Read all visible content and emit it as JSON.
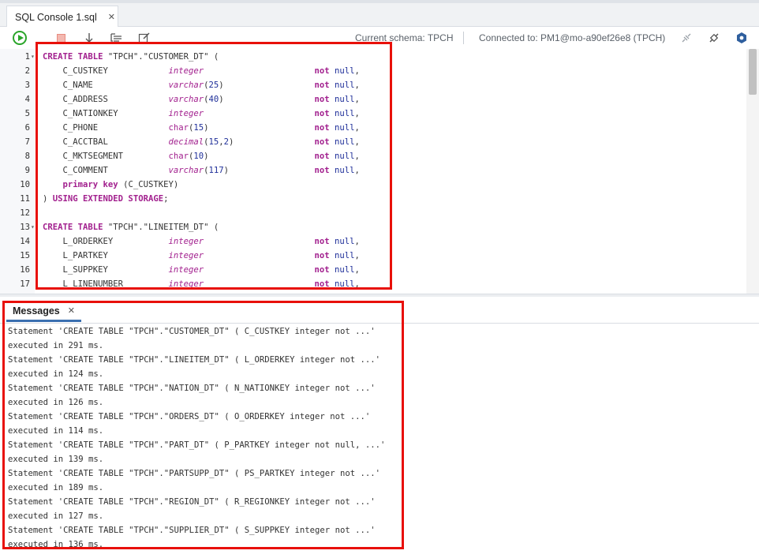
{
  "tab": {
    "title": "SQL Console 1.sql",
    "close": "✕"
  },
  "toolbar": {
    "current_schema": "Current schema: TPCH",
    "connected_to": "Connected to: PM1@mo-a90ef26e8 (TPCH)"
  },
  "editor": {
    "lines": [
      [
        [
          "CREATE TABLE",
          "kw"
        ],
        [
          " \"TPCH\".\"CUSTOMER_DT\" (",
          ""
        ]
      ],
      [
        [
          "    C_CUSTKEY            ",
          ""
        ],
        [
          "integer",
          "ty"
        ],
        [
          "                      ",
          ""
        ],
        [
          "not",
          "nn"
        ],
        [
          " ",
          ""
        ],
        [
          "null",
          "nm"
        ],
        [
          ",",
          ""
        ]
      ],
      [
        [
          "    C_NAME               ",
          ""
        ],
        [
          "varchar",
          "ty"
        ],
        [
          "(",
          ""
        ],
        [
          "25",
          "nm"
        ],
        [
          ")",
          ""
        ],
        [
          "                  ",
          ""
        ],
        [
          "not",
          "nn"
        ],
        [
          " ",
          ""
        ],
        [
          "null",
          "nm"
        ],
        [
          ",",
          ""
        ]
      ],
      [
        [
          "    C_ADDRESS            ",
          ""
        ],
        [
          "varchar",
          "ty"
        ],
        [
          "(",
          ""
        ],
        [
          "40",
          "nm"
        ],
        [
          ")",
          ""
        ],
        [
          "                  ",
          ""
        ],
        [
          "not",
          "nn"
        ],
        [
          " ",
          ""
        ],
        [
          "null",
          "nm"
        ],
        [
          ",",
          ""
        ]
      ],
      [
        [
          "    C_NATIONKEY          ",
          ""
        ],
        [
          "integer",
          "ty"
        ],
        [
          "                      ",
          ""
        ],
        [
          "not",
          "nn"
        ],
        [
          " ",
          ""
        ],
        [
          "null",
          "nm"
        ],
        [
          ",",
          ""
        ]
      ],
      [
        [
          "    C_PHONE              ",
          ""
        ],
        [
          "char",
          "ty2"
        ],
        [
          "(",
          ""
        ],
        [
          "15",
          "nm"
        ],
        [
          ")",
          ""
        ],
        [
          "                     ",
          ""
        ],
        [
          "not",
          "nn"
        ],
        [
          " ",
          ""
        ],
        [
          "null",
          "nm"
        ],
        [
          ",",
          ""
        ]
      ],
      [
        [
          "    C_ACCTBAL            ",
          ""
        ],
        [
          "decimal",
          "ty"
        ],
        [
          "(",
          ""
        ],
        [
          "15",
          "nm"
        ],
        [
          ",",
          ""
        ],
        [
          "2",
          "nm"
        ],
        [
          ")",
          ""
        ],
        [
          "                ",
          ""
        ],
        [
          "not",
          "nn"
        ],
        [
          " ",
          ""
        ],
        [
          "null",
          "nm"
        ],
        [
          ",",
          ""
        ]
      ],
      [
        [
          "    C_MKTSEGMENT         ",
          ""
        ],
        [
          "char",
          "ty2"
        ],
        [
          "(",
          ""
        ],
        [
          "10",
          "nm"
        ],
        [
          ")",
          ""
        ],
        [
          "                     ",
          ""
        ],
        [
          "not",
          "nn"
        ],
        [
          " ",
          ""
        ],
        [
          "null",
          "nm"
        ],
        [
          ",",
          ""
        ]
      ],
      [
        [
          "    C_COMMENT            ",
          ""
        ],
        [
          "varchar",
          "ty"
        ],
        [
          "(",
          ""
        ],
        [
          "117",
          "nm"
        ],
        [
          ")",
          ""
        ],
        [
          "                 ",
          ""
        ],
        [
          "not",
          "nn"
        ],
        [
          " ",
          ""
        ],
        [
          "null",
          "nm"
        ],
        [
          ",",
          ""
        ]
      ],
      [
        [
          "    ",
          ""
        ],
        [
          "primary key",
          "kw"
        ],
        [
          " (C_CUSTKEY)",
          ""
        ]
      ],
      [
        [
          ") ",
          ""
        ],
        [
          "USING EXTENDED STORAGE",
          "kw"
        ],
        [
          ";",
          ""
        ]
      ],
      [
        [
          "",
          ""
        ]
      ],
      [
        [
          "CREATE TABLE",
          "kw"
        ],
        [
          " \"TPCH\".\"LINEITEM_DT\" (",
          ""
        ]
      ],
      [
        [
          "    L_ORDERKEY           ",
          ""
        ],
        [
          "integer",
          "ty"
        ],
        [
          "                      ",
          ""
        ],
        [
          "not",
          "nn"
        ],
        [
          " ",
          ""
        ],
        [
          "null",
          "nm"
        ],
        [
          ",",
          ""
        ]
      ],
      [
        [
          "    L_PARTKEY            ",
          ""
        ],
        [
          "integer",
          "ty"
        ],
        [
          "                      ",
          ""
        ],
        [
          "not",
          "nn"
        ],
        [
          " ",
          ""
        ],
        [
          "null",
          "nm"
        ],
        [
          ",",
          ""
        ]
      ],
      [
        [
          "    L_SUPPKEY            ",
          ""
        ],
        [
          "integer",
          "ty"
        ],
        [
          "                      ",
          ""
        ],
        [
          "not",
          "nn"
        ],
        [
          " ",
          ""
        ],
        [
          "null",
          "nm"
        ],
        [
          ",",
          ""
        ]
      ],
      [
        [
          "    L_LINENUMBER         ",
          ""
        ],
        [
          "integer",
          "ty"
        ],
        [
          "                      ",
          ""
        ],
        [
          "not",
          "nn"
        ],
        [
          " ",
          ""
        ],
        [
          "null",
          "nm"
        ],
        [
          ",",
          ""
        ]
      ]
    ],
    "line_numbers": [
      "1",
      "2",
      "3",
      "4",
      "5",
      "6",
      "7",
      "8",
      "9",
      "10",
      "11",
      "12",
      "13",
      "14",
      "15",
      "16",
      "17"
    ],
    "fold_lines": [
      1,
      13
    ]
  },
  "messages": {
    "tab_label": "Messages",
    "close": "✕",
    "lines": [
      "Statement 'CREATE TABLE \"TPCH\".\"CUSTOMER_DT\" ( C_CUSTKEY integer not ...'",
      "executed in 291 ms.",
      "Statement 'CREATE TABLE \"TPCH\".\"LINEITEM_DT\" ( L_ORDERKEY integer not ...'",
      "executed in 124 ms.",
      "Statement 'CREATE TABLE \"TPCH\".\"NATION_DT\" ( N_NATIONKEY integer not ...'",
      "executed in 126 ms.",
      "Statement 'CREATE TABLE \"TPCH\".\"ORDERS_DT\" ( O_ORDERKEY integer not ...'",
      "executed in 114 ms.",
      "Statement 'CREATE TABLE \"TPCH\".\"PART_DT\" ( P_PARTKEY integer not null, ...'",
      "executed in 139 ms.",
      "Statement 'CREATE TABLE \"TPCH\".\"PARTSUPP_DT\" ( PS_PARTKEY integer not ...'",
      "executed in 189 ms.",
      "Statement 'CREATE TABLE \"TPCH\".\"REGION_DT\" ( R_REGIONKEY integer not ...'",
      "executed in 127 ms.",
      "Statement 'CREATE TABLE \"TPCH\".\"SUPPLIER_DT\" ( S_SUPPKEY integer not ...'",
      "executed in 136 ms."
    ]
  },
  "colors": {
    "keyword": "#a2208e",
    "number": "#1f2f99",
    "highlight": "#e8100a",
    "run": "#2aa52a"
  }
}
